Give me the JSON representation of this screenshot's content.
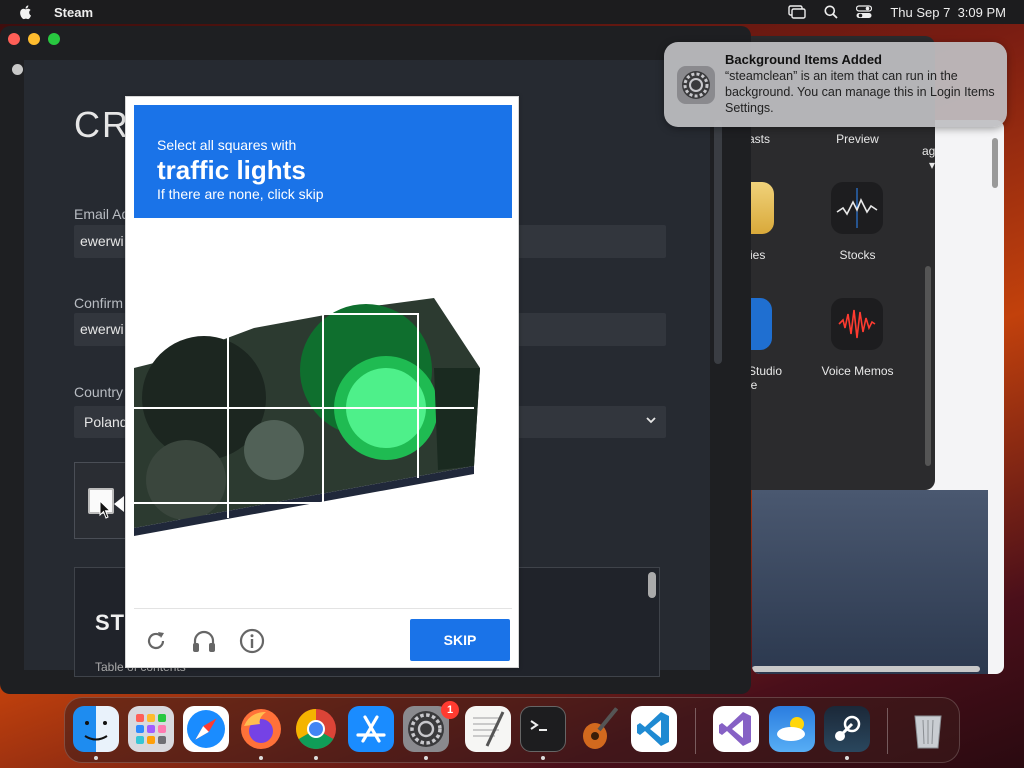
{
  "menubar": {
    "app_name": "Steam",
    "date": "Thu Sep 7",
    "time": "3:09 PM"
  },
  "steam": {
    "page_title": "CRE",
    "email_label": "Email Ad",
    "email_value": "ewerwi",
    "confirm_label": "Confirm",
    "confirm_value": "ewerwi",
    "country_label": "Country",
    "country_value": "Poland",
    "ssa_title": "STE",
    "ssa_sub": "Table of contents"
  },
  "captcha": {
    "instruction": "Select all squares with",
    "target": "traffic lights",
    "hint": "If there are none, click skip",
    "skip_label": "SKIP",
    "icons": [
      "reload-icon",
      "audio-icon",
      "info-icon"
    ]
  },
  "apps_window": {
    "labels": {
      "podcasts": "asts",
      "preview": "Preview",
      "usage": "age",
      "notes": "ies",
      "stocks": "Stocks",
      "studio": "Studio",
      "studio2": "le",
      "voice_memos": "Voice Memos"
    }
  },
  "notification": {
    "title": "Background Items Added",
    "body": "“steamclean” is an item that can run in the background. You can manage this in Login Items Settings."
  },
  "dock": {
    "apps": [
      "Finder",
      "Launchpad",
      "Safari",
      "Firefox",
      "Chrome",
      "App Store",
      "System Settings",
      "TextEdit",
      "Terminal",
      "GarageBand",
      "VS Code",
      "Visual Studio",
      "Weather",
      "Steam",
      "Trash"
    ],
    "settings_badge": "1"
  }
}
